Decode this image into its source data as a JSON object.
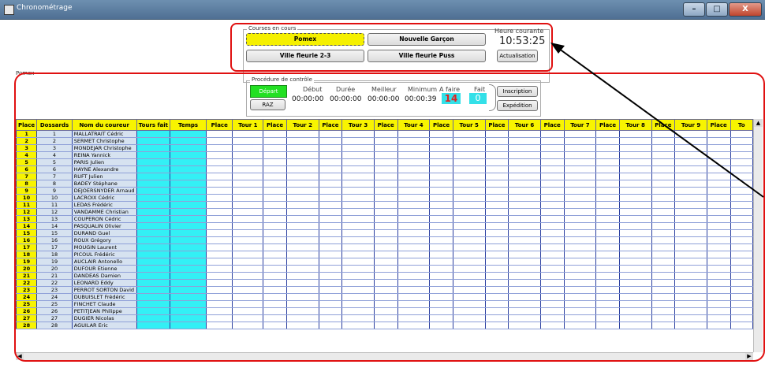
{
  "window": {
    "title": "Chronométrage",
    "min": "–",
    "max": "□",
    "close": "X"
  },
  "courses": {
    "legend": "Courses en cours",
    "buttons": [
      "Pomex",
      "Nouvelle Garçon",
      "Ville fleurie 2-3",
      "Ville fleurie Puss"
    ]
  },
  "heure": {
    "label": "Heure courante",
    "value": "10:53:25",
    "button": "Actualisation"
  },
  "course_label": "Pomex",
  "procedure": {
    "legend": "Procédure de contrôle",
    "depart": "Départ",
    "raz": "RAZ",
    "debut_label": "Début",
    "debut": "00:00:00",
    "duree_label": "Durée",
    "duree": "00:00:00",
    "meilleur_label": "Meilleur",
    "meilleur": "00:00:00",
    "minimum_label": "Minimum",
    "minimum": "00:00:39",
    "afaire_label": "A faire",
    "afaire": "14",
    "fait_label": "Fait",
    "fait": "0",
    "inscription": "Inscription",
    "expedition": "Expédition"
  },
  "table": {
    "headers": [
      "Place",
      "Dossards",
      "Nom du coureur",
      "Tours fait",
      "Temps",
      "Place",
      "Tour 1",
      "Place",
      "Tour 2",
      "Place",
      "Tour 3",
      "Place",
      "Tour 4",
      "Place",
      "Tour 5",
      "Place",
      "Tour 6",
      "Place",
      "Tour 7",
      "Place",
      "Tour 8",
      "Place",
      "Tour 9",
      "Place",
      "To"
    ],
    "rows": [
      {
        "place": "1",
        "doss": "1",
        "nom": "MALLATRAIT Cédric"
      },
      {
        "place": "2",
        "doss": "2",
        "nom": "SERMET Christophe"
      },
      {
        "place": "3",
        "doss": "3",
        "nom": "MONDEJAR Christophe"
      },
      {
        "place": "4",
        "doss": "4",
        "nom": "REINA Yannick"
      },
      {
        "place": "5",
        "doss": "5",
        "nom": "PARIS Julien"
      },
      {
        "place": "6",
        "doss": "6",
        "nom": "HAYNE Alexandre"
      },
      {
        "place": "7",
        "doss": "7",
        "nom": "RUFT Julien"
      },
      {
        "place": "8",
        "doss": "8",
        "nom": "BADEY Stéphane"
      },
      {
        "place": "9",
        "doss": "9",
        "nom": "DEJOERSNYDER Arnaud"
      },
      {
        "place": "10",
        "doss": "10",
        "nom": "LACROIX Cédric"
      },
      {
        "place": "11",
        "doss": "11",
        "nom": "LEDAS Frédéric"
      },
      {
        "place": "12",
        "doss": "12",
        "nom": "VANDAMME Christian"
      },
      {
        "place": "13",
        "doss": "13",
        "nom": "COUPERON Cédric"
      },
      {
        "place": "14",
        "doss": "14",
        "nom": "PASQUALIN Olivier"
      },
      {
        "place": "15",
        "doss": "15",
        "nom": "DURAND Guel"
      },
      {
        "place": "16",
        "doss": "16",
        "nom": "ROUX Grégory"
      },
      {
        "place": "17",
        "doss": "17",
        "nom": "MOUGIN Laurent"
      },
      {
        "place": "18",
        "doss": "18",
        "nom": "PICOUL Frédéric"
      },
      {
        "place": "19",
        "doss": "19",
        "nom": "AUCLAIR Antonello"
      },
      {
        "place": "20",
        "doss": "20",
        "nom": "DUFOUR Etienne"
      },
      {
        "place": "21",
        "doss": "21",
        "nom": "DANDEAS Damien"
      },
      {
        "place": "22",
        "doss": "22",
        "nom": "LEONARD Eddy"
      },
      {
        "place": "23",
        "doss": "23",
        "nom": "PERROT SORTON David"
      },
      {
        "place": "24",
        "doss": "24",
        "nom": "DUBUISLET Frédéric"
      },
      {
        "place": "25",
        "doss": "25",
        "nom": "FINCHET Claude"
      },
      {
        "place": "26",
        "doss": "26",
        "nom": "PETITJEAN Philippe"
      },
      {
        "place": "27",
        "doss": "27",
        "nom": "DUGIER Nicolas"
      },
      {
        "place": "28",
        "doss": "28",
        "nom": "AGUILAR Eric"
      }
    ]
  }
}
